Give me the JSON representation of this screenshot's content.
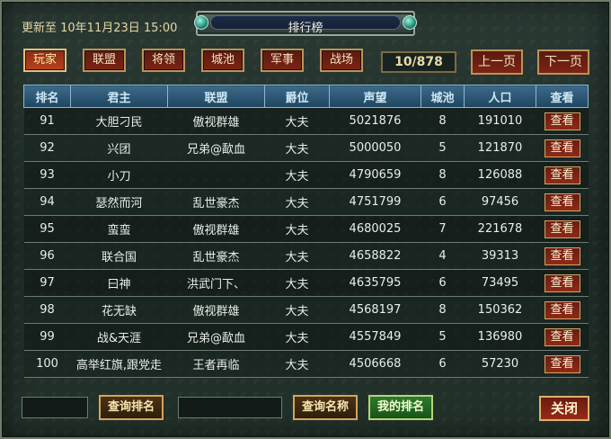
{
  "header": {
    "update_text": "更新至 10年11月23日 15:00",
    "title": "排行榜"
  },
  "tabs": [
    {
      "label": "玩家",
      "active": true
    },
    {
      "label": "联盟",
      "active": false
    },
    {
      "label": "将领",
      "active": false
    },
    {
      "label": "城池",
      "active": false
    },
    {
      "label": "军事",
      "active": false
    },
    {
      "label": "战场",
      "active": false
    }
  ],
  "pager": {
    "page_text": "10/878",
    "prev_label": "上一页",
    "next_label": "下一页"
  },
  "table": {
    "columns": [
      "排名",
      "君主",
      "联盟",
      "爵位",
      "声望",
      "城池",
      "人口",
      "查看"
    ],
    "view_label": "查看",
    "rows": [
      {
        "rank": "91",
        "lord": "大胆刁民",
        "alliance": "傲视群雄",
        "title": "大夫",
        "prestige": "5021876",
        "cities": "8",
        "population": "191010"
      },
      {
        "rank": "92",
        "lord": "兴团",
        "alliance": "兄弟@歃血",
        "title": "大夫",
        "prestige": "5000050",
        "cities": "5",
        "population": "121870"
      },
      {
        "rank": "93",
        "lord": "小刀",
        "alliance": "",
        "title": "大夫",
        "prestige": "4790659",
        "cities": "8",
        "population": "126088"
      },
      {
        "rank": "94",
        "lord": "瑟然而河",
        "alliance": "乱世豪杰",
        "title": "大夫",
        "prestige": "4751799",
        "cities": "6",
        "population": "97456"
      },
      {
        "rank": "95",
        "lord": "蛮蛮",
        "alliance": "傲视群雄",
        "title": "大夫",
        "prestige": "4680025",
        "cities": "7",
        "population": "221678"
      },
      {
        "rank": "96",
        "lord": "联合国",
        "alliance": "乱世豪杰",
        "title": "大夫",
        "prestige": "4658822",
        "cities": "4",
        "population": "39313"
      },
      {
        "rank": "97",
        "lord": "曰神",
        "alliance": "洪武门下、",
        "title": "大夫",
        "prestige": "4635795",
        "cities": "6",
        "population": "73495"
      },
      {
        "rank": "98",
        "lord": "花无缺",
        "alliance": "傲视群雄",
        "title": "大夫",
        "prestige": "4568197",
        "cities": "8",
        "population": "150362"
      },
      {
        "rank": "99",
        "lord": "战&天涯",
        "alliance": "兄弟@歃血",
        "title": "大夫",
        "prestige": "4557849",
        "cities": "5",
        "population": "136980"
      },
      {
        "rank": "100",
        "lord": "高举红旗,跟党走",
        "alliance": "王者再临",
        "title": "大夫",
        "prestige": "4506668",
        "cities": "6",
        "population": "57230"
      }
    ]
  },
  "footer": {
    "rank_input_value": "",
    "query_rank_label": "查询排名",
    "name_input_value": "",
    "query_name_label": "查询名称",
    "my_rank_label": "我的排名",
    "close_label": "关闭"
  }
}
